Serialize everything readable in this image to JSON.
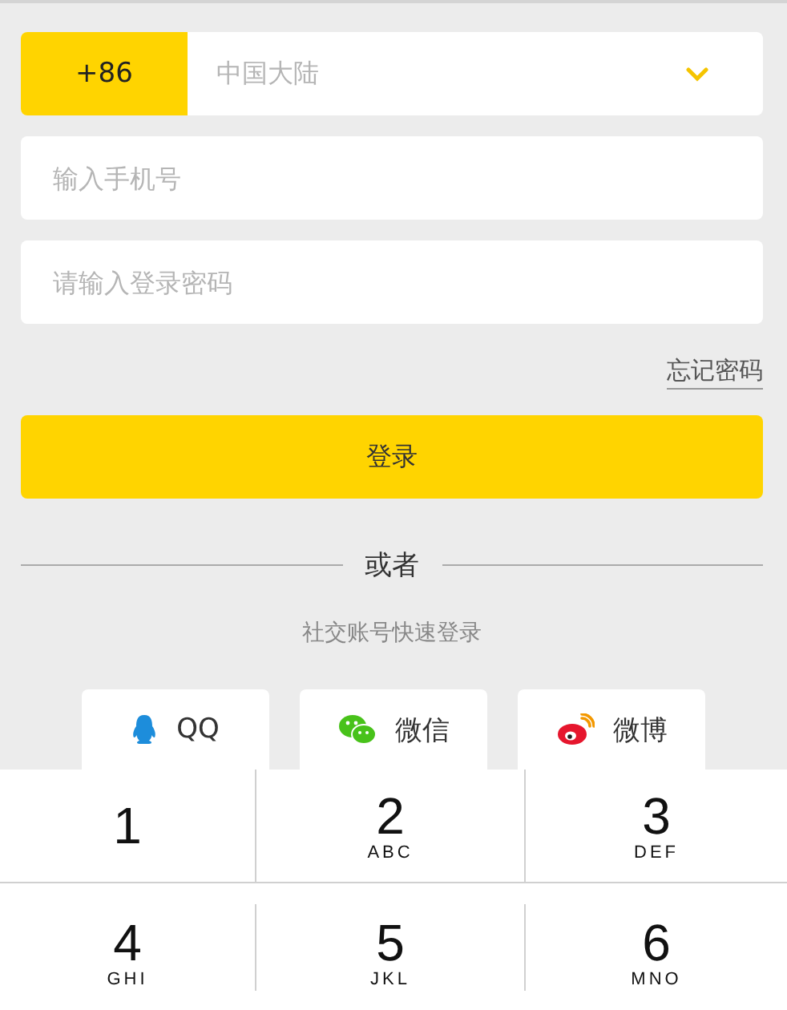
{
  "country": {
    "code": "+86",
    "name": "中国大陆"
  },
  "phone_field": {
    "placeholder": "输入手机号"
  },
  "password_field": {
    "placeholder": "请输入登录密码"
  },
  "forgot_link": "忘记密码",
  "login_button": "登录",
  "divider": "或者",
  "social_hint": "社交账号快速登录",
  "social_buttons": [
    {
      "kind": "qq",
      "label": "QQ"
    },
    {
      "kind": "wechat",
      "label": "微信"
    },
    {
      "kind": "weibo",
      "label": "微博"
    }
  ],
  "keypad": [
    {
      "digit": "1"
    },
    {
      "digit": "2",
      "letters": "ABC"
    },
    {
      "digit": "3",
      "letters": "DEF"
    },
    {
      "digit": "4",
      "letters": "GHI"
    },
    {
      "digit": "5",
      "letters": "JKL"
    },
    {
      "digit": "6",
      "letters": "MNO"
    }
  ]
}
